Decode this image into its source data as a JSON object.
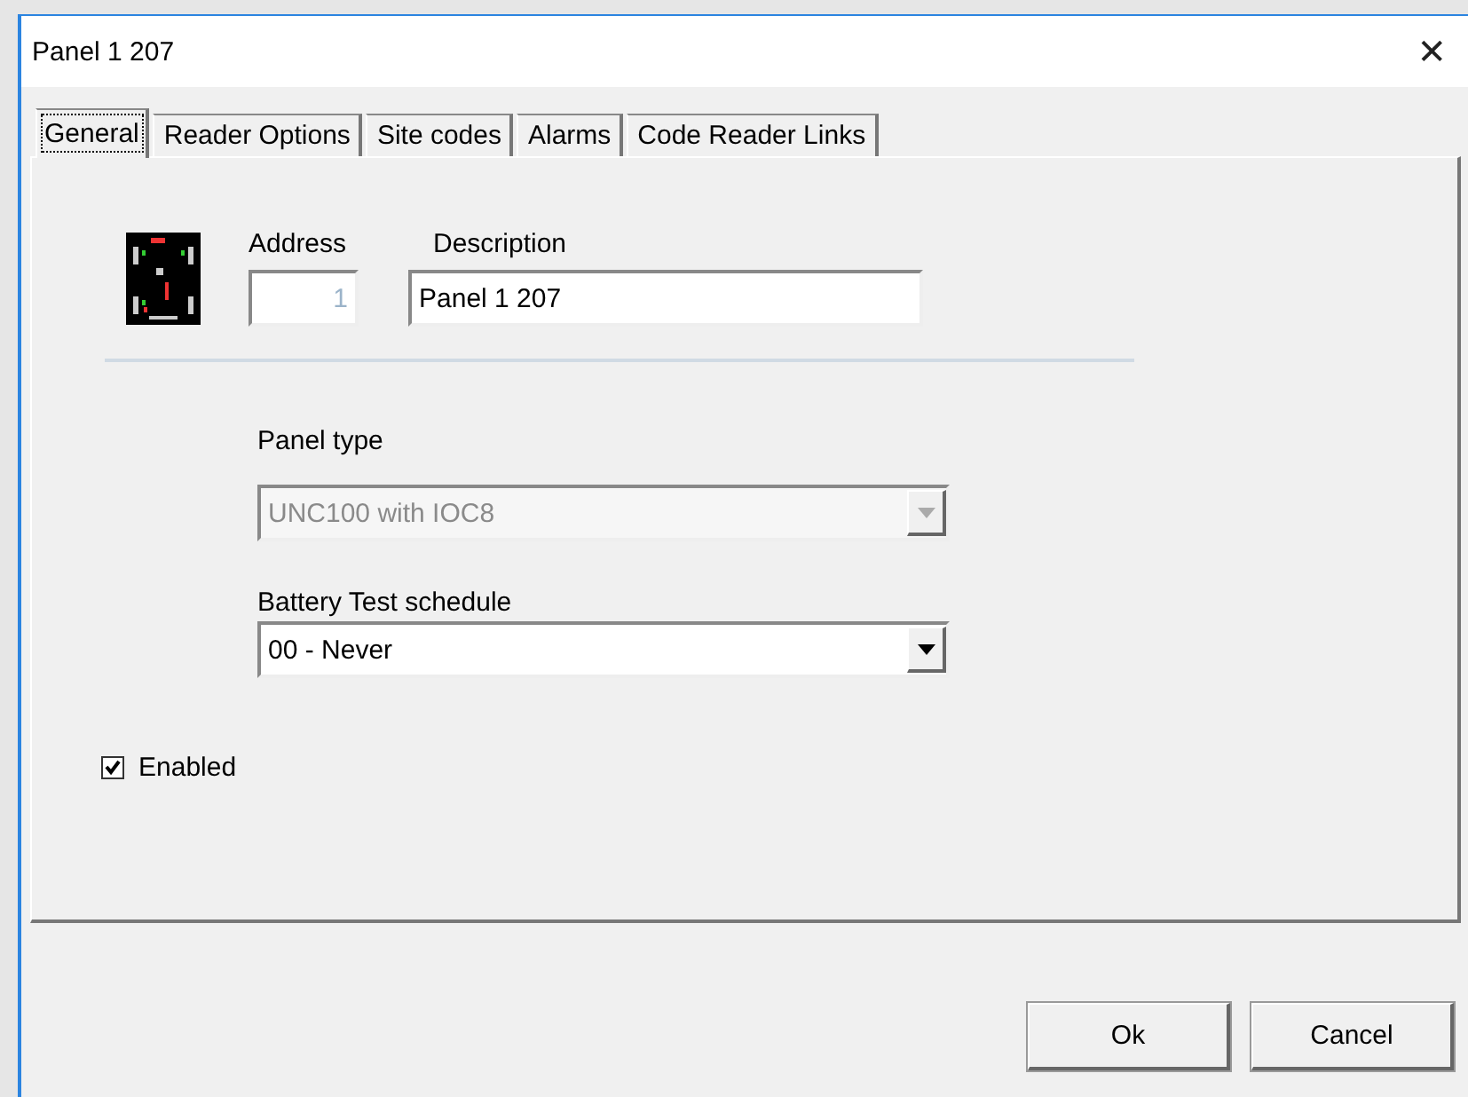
{
  "window": {
    "title": "Panel 1 207",
    "close": "✕"
  },
  "tabs": [
    {
      "label": "General",
      "selected": true
    },
    {
      "label": "Reader Options",
      "selected": false
    },
    {
      "label": "Site codes",
      "selected": false
    },
    {
      "label": "Alarms",
      "selected": false
    },
    {
      "label": "Code Reader Links",
      "selected": false
    }
  ],
  "general": {
    "address": {
      "label": "Address",
      "value": "1",
      "disabled": true
    },
    "description": {
      "label": "Description",
      "value": "Panel 1 207"
    },
    "panel_type": {
      "label": "Panel type",
      "value": "UNC100 with IOC8",
      "disabled": true
    },
    "battery_test_schedule": {
      "label": "Battery Test schedule",
      "value": "00 - Never",
      "disabled": false
    },
    "enabled": {
      "label": "Enabled",
      "checked": true
    }
  },
  "buttons": [
    "Ok",
    "Cancel"
  ]
}
